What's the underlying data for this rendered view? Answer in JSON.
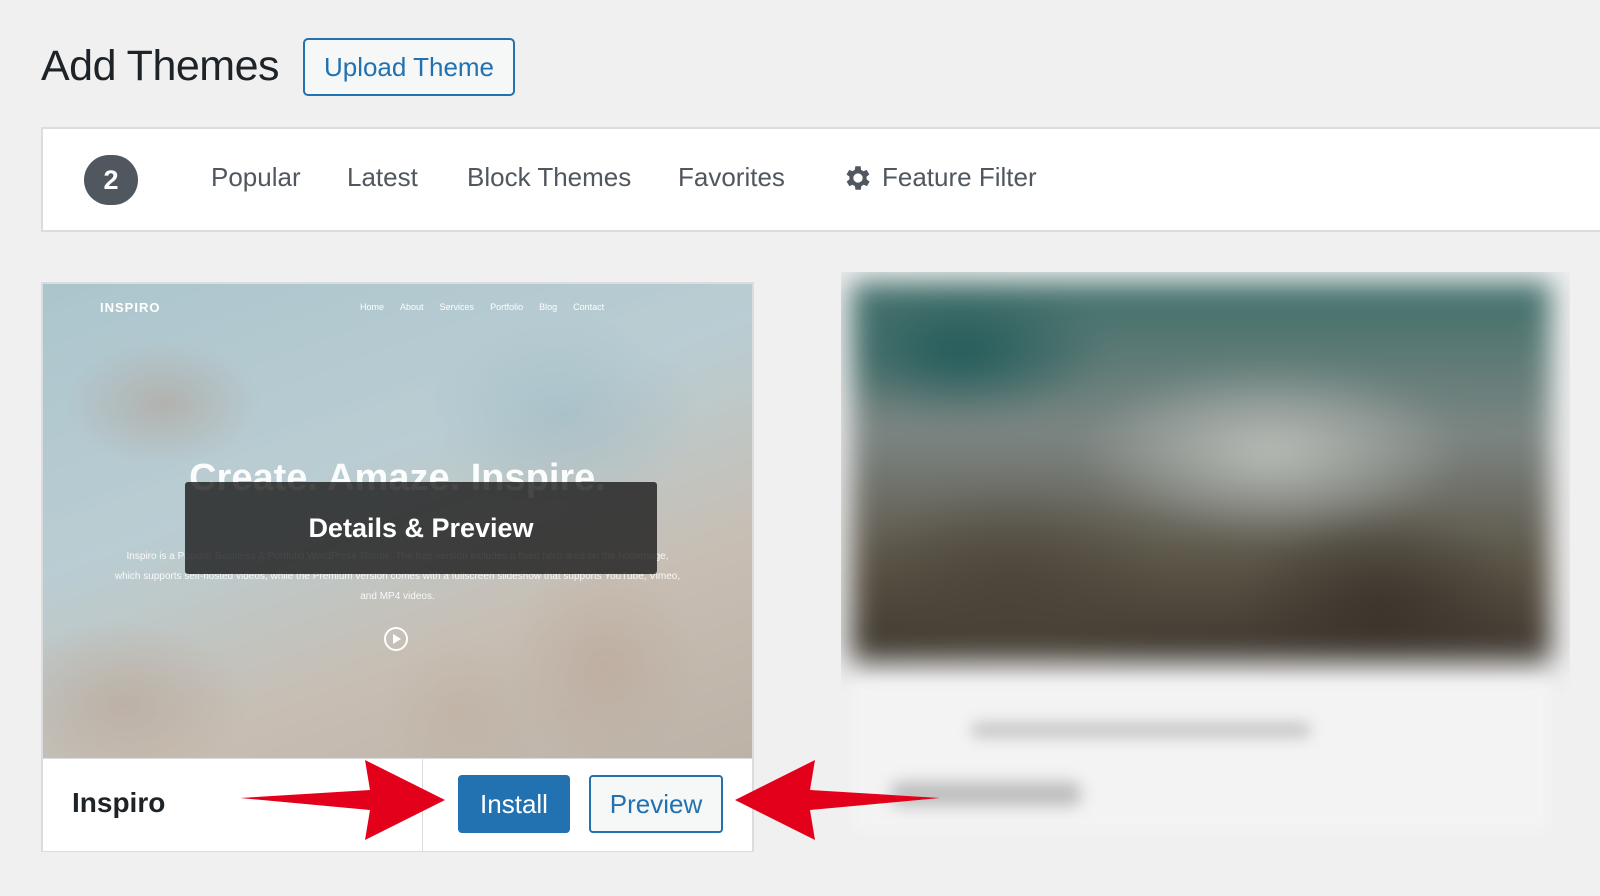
{
  "header": {
    "title": "Add Themes",
    "upload_button": "Upload Theme"
  },
  "filter_bar": {
    "count": "2",
    "links": [
      "Popular",
      "Latest",
      "Block Themes",
      "Favorites"
    ],
    "feature_filter": "Feature Filter"
  },
  "theme": {
    "name": "Inspiro",
    "overlay_label": "Details & Preview",
    "install_label": "Install",
    "preview_label": "Preview",
    "screenshot": {
      "brand": "INSPIRO",
      "nav": [
        "Home",
        "About",
        "Services",
        "Portfolio",
        "Blog",
        "Contact"
      ],
      "headline": "Create. Amaze. Inspire.",
      "description": "Inspiro is a Popular Business & Portfolio WordPress Theme. The free version includes a fixed hero area on the homepage, which supports self-hosted videos, while the Premium version comes with a fullscreen slideshow that supports YouTube, Vimeo, and MP4 videos."
    }
  },
  "colors": {
    "accent": "#2271b1",
    "annotation_arrow": "#e3001b",
    "badge": "#50575e"
  }
}
